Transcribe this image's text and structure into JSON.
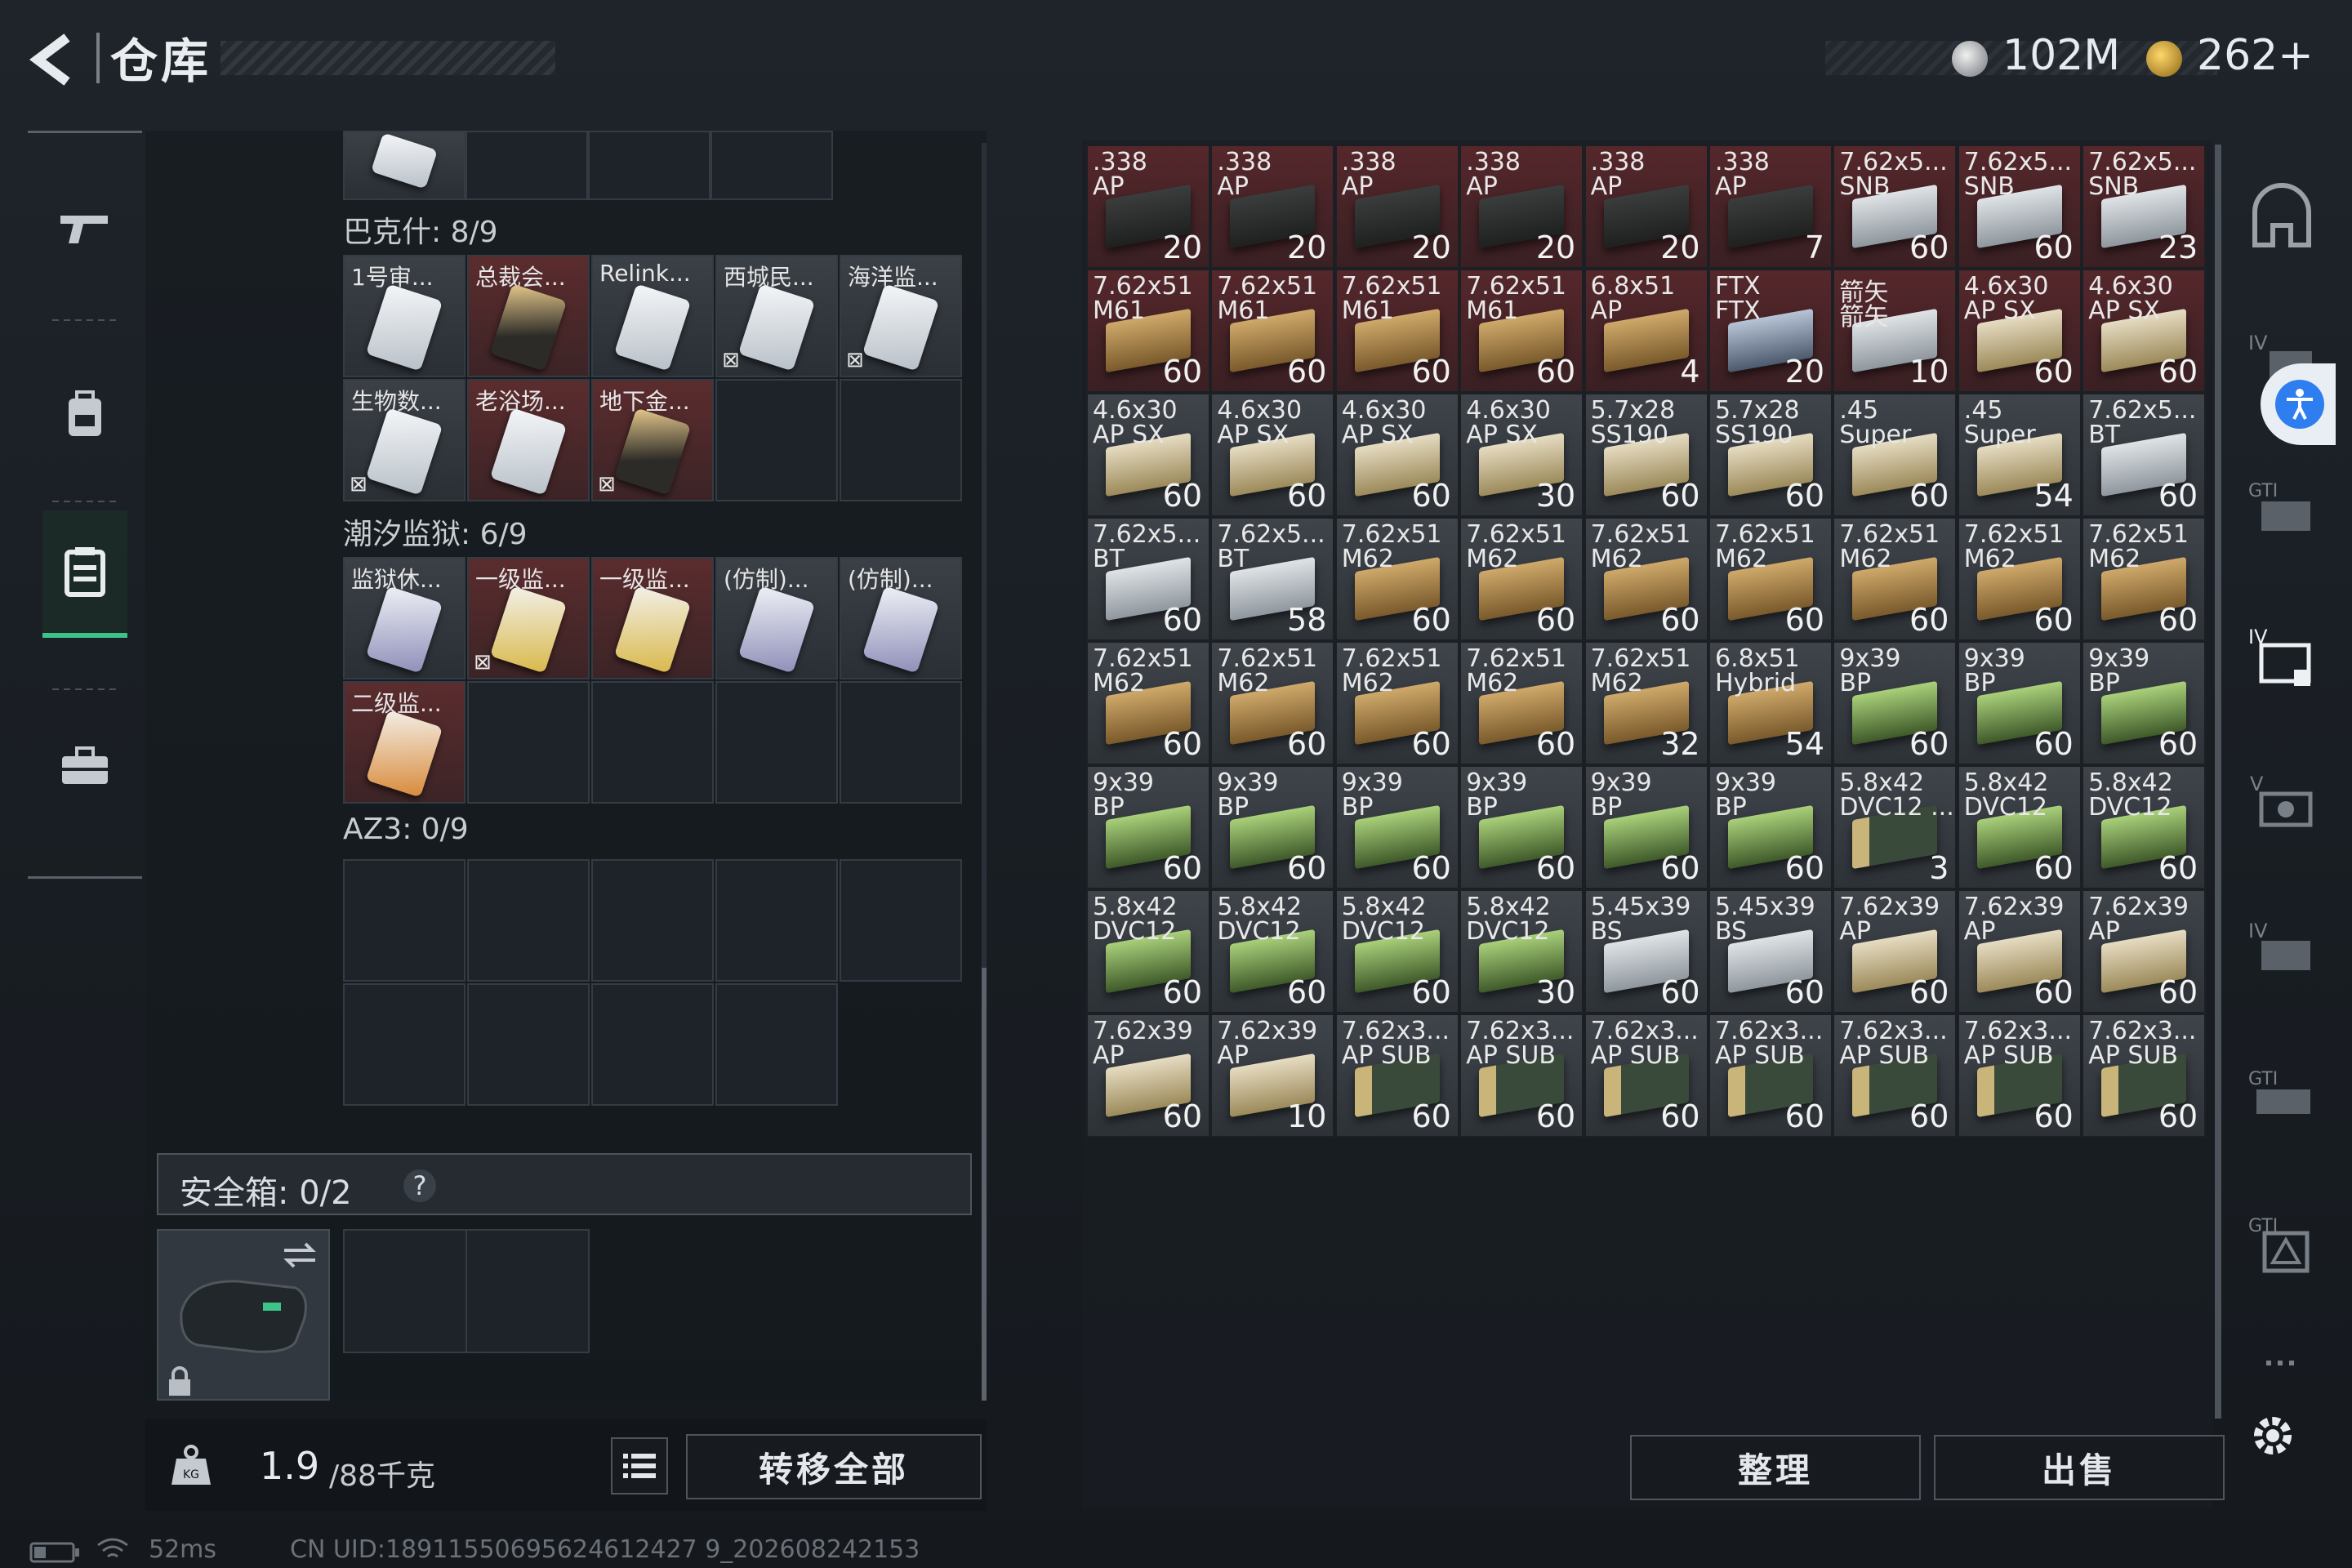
{
  "header": {
    "title": "仓库",
    "currency1": "102M",
    "currency2": "262+"
  },
  "left_nav": [
    "weapon-icon",
    "backpack-icon",
    "storage-icon",
    "toolbox-icon"
  ],
  "sections": [
    {
      "name": "巴克什: 8/9",
      "items": [
        {
          "label": "1号审...",
          "card": "white",
          "locked": false
        },
        {
          "label": "总裁会...",
          "card": "gold",
          "locked": false
        },
        {
          "label": "Relink...",
          "card": "white",
          "locked": false
        },
        {
          "label": "西城民...",
          "card": "white",
          "locked": true
        },
        {
          "label": "海洋监...",
          "card": "white",
          "locked": true
        },
        {
          "label": "生物数...",
          "card": "white",
          "locked": true
        },
        {
          "label": "老浴场...",
          "card": "white",
          "locked": false
        },
        {
          "label": "地下金...",
          "card": "gold",
          "locked": true
        }
      ]
    },
    {
      "name": "潮汐监狱: 6/9",
      "items": [
        {
          "label": "监狱休...",
          "card": "purple",
          "locked": false
        },
        {
          "label": "一级监...",
          "card": "yellow",
          "locked": true
        },
        {
          "label": "一级监...",
          "card": "yellow",
          "locked": false
        },
        {
          "label": "(仿制)...",
          "card": "purple",
          "locked": false
        },
        {
          "label": "(仿制)...",
          "card": "purple",
          "locked": false
        },
        {
          "label": "二级监...",
          "card": "orange",
          "locked": false
        }
      ]
    },
    {
      "name": "AZ3: 0/9",
      "items": []
    }
  ],
  "safe_box": {
    "label": "安全箱: 0/2",
    "help": "?"
  },
  "bottom_left": {
    "weight": "1.9",
    "weight_max": "/88千克",
    "transfer_all": "转移全部"
  },
  "status": {
    "ping": "52ms",
    "uid": "CN UID:18911550695624612427 9_202608242153"
  },
  "right_buttons": {
    "sort": "整理",
    "sell": "出售"
  },
  "ammo": [
    {
      "n1": ".338",
      "n2": "AP",
      "q": "20",
      "bg": "red",
      "box": "dark"
    },
    {
      "n1": ".338",
      "n2": "AP",
      "q": "20",
      "bg": "red",
      "box": "dark"
    },
    {
      "n1": ".338",
      "n2": "AP",
      "q": "20",
      "bg": "red",
      "box": "dark"
    },
    {
      "n1": ".338",
      "n2": "AP",
      "q": "20",
      "bg": "red",
      "box": "dark"
    },
    {
      "n1": ".338",
      "n2": "AP",
      "q": "20",
      "bg": "red",
      "box": "dark"
    },
    {
      "n1": ".338",
      "n2": "AP",
      "q": "7",
      "bg": "red",
      "box": "dark"
    },
    {
      "n1": "7.62x5...",
      "n2": "SNB",
      "q": "60",
      "bg": "red",
      "box": "silver"
    },
    {
      "n1": "7.62x5...",
      "n2": "SNB",
      "q": "60",
      "bg": "red",
      "box": "silver"
    },
    {
      "n1": "7.62x5...",
      "n2": "SNB",
      "q": "23",
      "bg": "red",
      "box": "silver"
    },
    {
      "n1": "7.62x51",
      "n2": "M61",
      "q": "60",
      "bg": "red",
      "box": "tan"
    },
    {
      "n1": "7.62x51",
      "n2": "M61",
      "q": "60",
      "bg": "red",
      "box": "tan"
    },
    {
      "n1": "7.62x51",
      "n2": "M61",
      "q": "60",
      "bg": "red",
      "box": "tan"
    },
    {
      "n1": "7.62x51",
      "n2": "M61",
      "q": "60",
      "bg": "red",
      "box": "tan"
    },
    {
      "n1": "6.8x51",
      "n2": "AP",
      "q": "4",
      "bg": "red",
      "box": "tan"
    },
    {
      "n1": "FTX",
      "n2": "FTX",
      "q": "20",
      "bg": "red",
      "box": "blue"
    },
    {
      "n1": "箭矢",
      "n2": "箭矢",
      "q": "10",
      "bg": "red",
      "box": "silver"
    },
    {
      "n1": "4.6x30",
      "n2": "AP SX",
      "q": "60",
      "bg": "red",
      "box": "cream"
    },
    {
      "n1": "4.6x30",
      "n2": "AP SX",
      "q": "60",
      "bg": "red",
      "box": "cream"
    },
    {
      "n1": "4.6x30",
      "n2": "AP SX",
      "q": "60",
      "bg": "gray",
      "box": "cream"
    },
    {
      "n1": "4.6x30",
      "n2": "AP SX",
      "q": "60",
      "bg": "gray",
      "box": "cream"
    },
    {
      "n1": "4.6x30",
      "n2": "AP SX",
      "q": "60",
      "bg": "gray",
      "box": "cream"
    },
    {
      "n1": "4.6x30",
      "n2": "AP SX",
      "q": "30",
      "bg": "gray",
      "box": "cream"
    },
    {
      "n1": "5.7x28",
      "n2": "SS190",
      "q": "60",
      "bg": "gray",
      "box": "cream"
    },
    {
      "n1": "5.7x28",
      "n2": "SS190",
      "q": "60",
      "bg": "gray",
      "box": "cream"
    },
    {
      "n1": ".45",
      "n2": "Super",
      "q": "60",
      "bg": "gray",
      "box": "cream"
    },
    {
      "n1": ".45",
      "n2": "Super",
      "q": "54",
      "bg": "gray",
      "box": "cream"
    },
    {
      "n1": "7.62x5...",
      "n2": "BT",
      "q": "60",
      "bg": "gray",
      "box": "silver"
    },
    {
      "n1": "7.62x5...",
      "n2": "BT",
      "q": "60",
      "bg": "gray",
      "box": "silver"
    },
    {
      "n1": "7.62x5...",
      "n2": "BT",
      "q": "58",
      "bg": "gray",
      "box": "silver"
    },
    {
      "n1": "7.62x51",
      "n2": "M62",
      "q": "60",
      "bg": "gray",
      "box": "tan"
    },
    {
      "n1": "7.62x51",
      "n2": "M62",
      "q": "60",
      "bg": "gray",
      "box": "tan"
    },
    {
      "n1": "7.62x51",
      "n2": "M62",
      "q": "60",
      "bg": "gray",
      "box": "tan"
    },
    {
      "n1": "7.62x51",
      "n2": "M62",
      "q": "60",
      "bg": "gray",
      "box": "tan"
    },
    {
      "n1": "7.62x51",
      "n2": "M62",
      "q": "60",
      "bg": "gray",
      "box": "tan"
    },
    {
      "n1": "7.62x51",
      "n2": "M62",
      "q": "60",
      "bg": "gray",
      "box": "tan"
    },
    {
      "n1": "7.62x51",
      "n2": "M62",
      "q": "60",
      "bg": "gray",
      "box": "tan"
    },
    {
      "n1": "7.62x51",
      "n2": "M62",
      "q": "60",
      "bg": "gray",
      "box": "tan"
    },
    {
      "n1": "7.62x51",
      "n2": "M62",
      "q": "60",
      "bg": "gray",
      "box": "tan"
    },
    {
      "n1": "7.62x51",
      "n2": "M62",
      "q": "60",
      "bg": "gray",
      "box": "tan"
    },
    {
      "n1": "7.62x51",
      "n2": "M62",
      "q": "60",
      "bg": "gray",
      "box": "tan"
    },
    {
      "n1": "7.62x51",
      "n2": "M62",
      "q": "32",
      "bg": "gray",
      "box": "tan"
    },
    {
      "n1": "6.8x51",
      "n2": "Hybrid",
      "q": "54",
      "bg": "gray",
      "box": "tan"
    },
    {
      "n1": "9x39",
      "n2": "BP",
      "q": "60",
      "bg": "gray",
      "box": "green"
    },
    {
      "n1": "9x39",
      "n2": "BP",
      "q": "60",
      "bg": "gray",
      "box": "green"
    },
    {
      "n1": "9x39",
      "n2": "BP",
      "q": "60",
      "bg": "gray",
      "box": "green"
    },
    {
      "n1": "9x39",
      "n2": "BP",
      "q": "60",
      "bg": "gray",
      "box": "green"
    },
    {
      "n1": "9x39",
      "n2": "BP",
      "q": "60",
      "bg": "gray",
      "box": "green"
    },
    {
      "n1": "9x39",
      "n2": "BP",
      "q": "60",
      "bg": "gray",
      "box": "green"
    },
    {
      "n1": "9x39",
      "n2": "BP",
      "q": "60",
      "bg": "gray",
      "box": "green"
    },
    {
      "n1": "9x39",
      "n2": "BP",
      "q": "60",
      "bg": "gray",
      "box": "green"
    },
    {
      "n1": "9x39",
      "n2": "BP",
      "q": "60",
      "bg": "gray",
      "box": "green"
    },
    {
      "n1": "5.8x42",
      "n2": "DVC12 ...",
      "q": "3",
      "bg": "gray",
      "box": "bolt"
    },
    {
      "n1": "5.8x42",
      "n2": "DVC12",
      "q": "60",
      "bg": "gray",
      "box": "green"
    },
    {
      "n1": "5.8x42",
      "n2": "DVC12",
      "q": "60",
      "bg": "gray",
      "box": "green"
    },
    {
      "n1": "5.8x42",
      "n2": "DVC12",
      "q": "60",
      "bg": "gray",
      "box": "green"
    },
    {
      "n1": "5.8x42",
      "n2": "DVC12",
      "q": "60",
      "bg": "gray",
      "box": "green"
    },
    {
      "n1": "5.8x42",
      "n2": "DVC12",
      "q": "60",
      "bg": "gray",
      "box": "green"
    },
    {
      "n1": "5.8x42",
      "n2": "DVC12",
      "q": "30",
      "bg": "gray",
      "box": "green"
    },
    {
      "n1": "5.45x39",
      "n2": "BS",
      "q": "60",
      "bg": "gray",
      "box": "silver"
    },
    {
      "n1": "5.45x39",
      "n2": "BS",
      "q": "60",
      "bg": "gray",
      "box": "silver"
    },
    {
      "n1": "7.62x39",
      "n2": "AP",
      "q": "60",
      "bg": "gray",
      "box": "cream"
    },
    {
      "n1": "7.62x39",
      "n2": "AP",
      "q": "60",
      "bg": "gray",
      "box": "cream"
    },
    {
      "n1": "7.62x39",
      "n2": "AP",
      "q": "60",
      "bg": "gray",
      "box": "cream"
    },
    {
      "n1": "7.62x39",
      "n2": "AP",
      "q": "60",
      "bg": "gray",
      "box": "cream"
    },
    {
      "n1": "7.62x39",
      "n2": "AP",
      "q": "10",
      "bg": "gray",
      "box": "cream"
    },
    {
      "n1": "7.62x3...",
      "n2": "AP SUB",
      "q": "60",
      "bg": "gray",
      "box": "bolt"
    },
    {
      "n1": "7.62x3...",
      "n2": "AP SUB",
      "q": "60",
      "bg": "gray",
      "box": "bolt"
    },
    {
      "n1": "7.62x3...",
      "n2": "AP SUB",
      "q": "60",
      "bg": "gray",
      "box": "bolt"
    },
    {
      "n1": "7.62x3...",
      "n2": "AP SUB",
      "q": "60",
      "bg": "gray",
      "box": "bolt"
    },
    {
      "n1": "7.62x3...",
      "n2": "AP SUB",
      "q": "60",
      "bg": "gray",
      "box": "bolt"
    },
    {
      "n1": "7.62x3...",
      "n2": "AP SUB",
      "q": "60",
      "bg": "gray",
      "box": "bolt"
    },
    {
      "n1": "7.62x3...",
      "n2": "AP SUB",
      "q": "60",
      "bg": "gray",
      "box": "bolt"
    }
  ]
}
